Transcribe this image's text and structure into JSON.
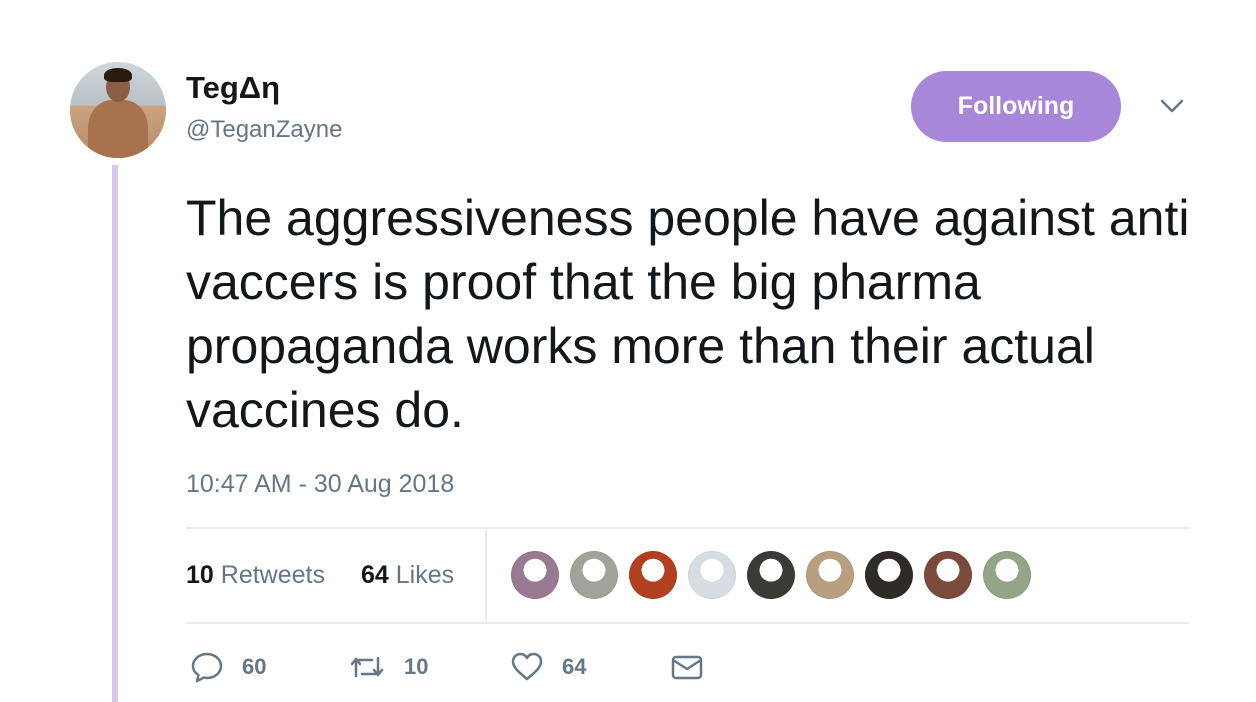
{
  "author": {
    "name": "TegΔη",
    "handle": "@TeganZayne"
  },
  "follow_button": {
    "label": "Following",
    "color": "#a886da"
  },
  "tweet": {
    "text": "The aggressiveness people have against anti vaccers is proof that the big pharma propaganda works more than their actual vaccines do.",
    "timestamp": "10:47 AM - 30 Aug 2018"
  },
  "stats": {
    "retweets_count": "10",
    "retweets_label": "Retweets",
    "likes_count": "64",
    "likes_label": "Likes"
  },
  "likers": [
    {
      "name": "liker-avatar-1",
      "color": "#9a7a92"
    },
    {
      "name": "liker-avatar-2",
      "color": "#9fa39a"
    },
    {
      "name": "liker-avatar-3",
      "color": "#b2401e"
    },
    {
      "name": "liker-avatar-4",
      "color": "#d6dde3"
    },
    {
      "name": "liker-avatar-5",
      "color": "#3a3a36"
    },
    {
      "name": "liker-avatar-6",
      "color": "#b89f7f"
    },
    {
      "name": "liker-avatar-7",
      "color": "#2f2b27"
    },
    {
      "name": "liker-avatar-8",
      "color": "#7a4a3c"
    },
    {
      "name": "liker-avatar-9",
      "color": "#93a487"
    }
  ],
  "actions": {
    "replies": "60",
    "retweets": "10",
    "likes": "64"
  },
  "colors": {
    "thread_line": "#d6c8ef",
    "muted_text": "#657786",
    "primary_text": "#14171a"
  }
}
